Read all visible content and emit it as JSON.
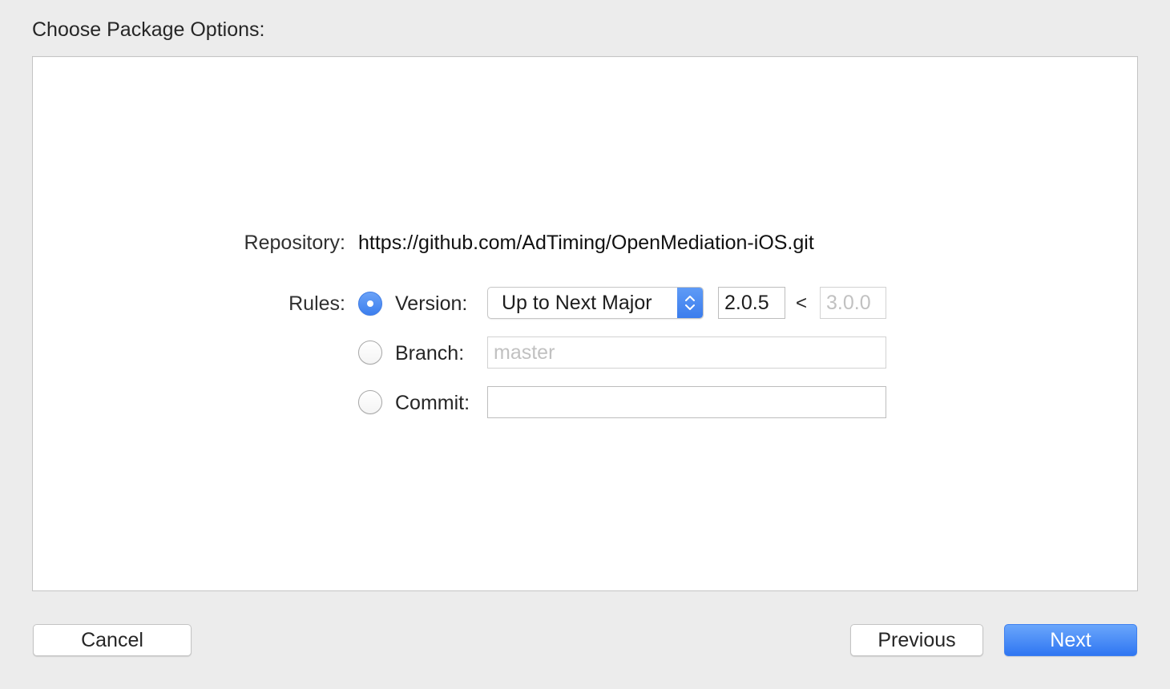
{
  "sheet": {
    "title": "Choose Package Options:"
  },
  "repository": {
    "label": "Repository:",
    "url": "https://github.com/AdTiming/OpenMediation-iOS.git"
  },
  "rules": {
    "label": "Rules:",
    "version": {
      "label": "Version:",
      "selected": true,
      "mode": "Up to Next Major",
      "min_version": "2.0.5",
      "separator": "<",
      "max_version_placeholder": "3.0.0"
    },
    "branch": {
      "label": "Branch:",
      "selected": false,
      "placeholder": "master"
    },
    "commit": {
      "label": "Commit:",
      "selected": false,
      "value": ""
    }
  },
  "buttons": {
    "cancel": "Cancel",
    "previous": "Previous",
    "next": "Next"
  },
  "colors": {
    "accent": "#3d7fee",
    "background": "#ececec",
    "panel": "#ffffff"
  }
}
